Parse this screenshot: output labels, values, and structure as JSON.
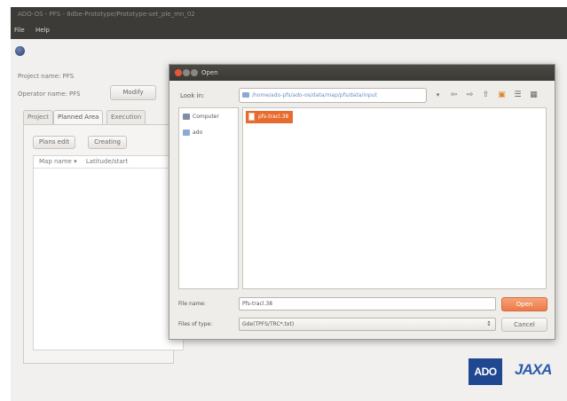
{
  "window": {
    "title": "ADO-OS - PFS - 8dbe-Prototype/Prototype-set_ple_mn_02",
    "menu": [
      "File",
      "Help"
    ]
  },
  "project": {
    "name_text": "Project name:  PFS",
    "operator_text": "Operator name:  PFS",
    "modify_label": "Modify"
  },
  "tabs": [
    "Project",
    "Planned Area",
    "Execution"
  ],
  "panel": {
    "buttons": [
      "Plans edit",
      "Creating"
    ],
    "columns": [
      "Map name  ▾",
      "Latitude/start"
    ]
  },
  "dialog": {
    "title": "Open",
    "look_in_label": "Look in:",
    "look_in_value": "/home/ado-pfs/ado-os/data/map/pfs/data/input",
    "places": [
      "Computer",
      "ado"
    ],
    "files": [
      "pfs-tracl.38"
    ],
    "file_name_label": "File name:",
    "file_name_value": "Pfs-tracl.38",
    "file_type_label": "Files of type:",
    "file_type_value": "Gde(TPFS/TRC*.txt)",
    "open_label": "Open",
    "cancel_label": "Cancel"
  },
  "logos": {
    "ado": "ADO",
    "jaxa": "JAXA"
  },
  "colors": {
    "titlebar": "#3c3b37",
    "accent": "#e76b2f",
    "logo_blue": "#1f4891"
  }
}
